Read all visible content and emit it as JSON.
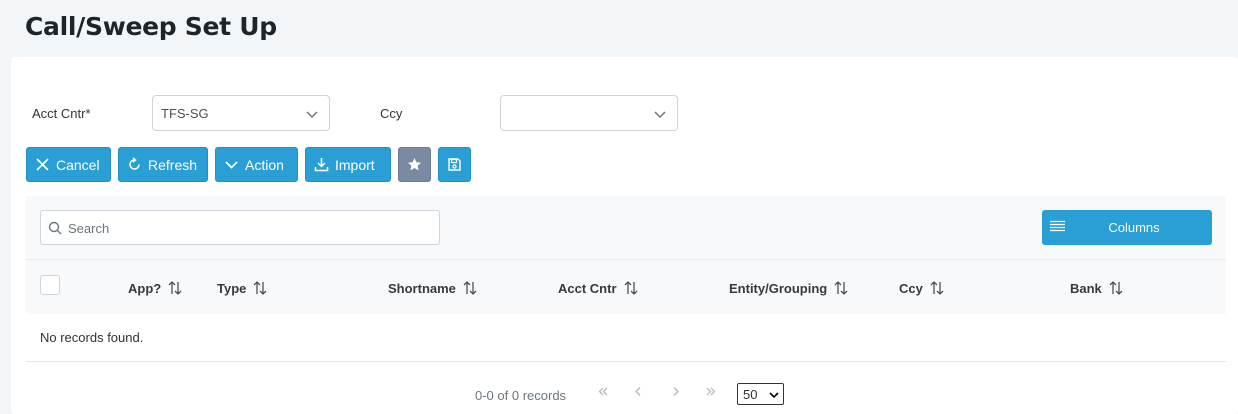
{
  "page": {
    "title": "Call/Sweep Set Up"
  },
  "filters": {
    "acct_cntr_label": "Acct Cntr*",
    "acct_cntr_value": "TFS-SG",
    "ccy_label": "Ccy",
    "ccy_value": ""
  },
  "toolbar": {
    "cancel": "Cancel",
    "refresh": "Refresh",
    "action": "Action",
    "import": "Import"
  },
  "table": {
    "search_placeholder": "Search",
    "columns_label": "Columns",
    "headers": [
      "App?",
      "Type",
      "Shortname",
      "Acct Cntr",
      "Entity/Grouping",
      "Ccy",
      "Bank"
    ],
    "empty_message": "No records found."
  },
  "pagination": {
    "info": "0-0 of 0 records",
    "rows_per_page": "50"
  },
  "colors": {
    "primary": "#2a9fd6",
    "secondary": "#7b8aa3",
    "background": "#f3f6f9"
  }
}
